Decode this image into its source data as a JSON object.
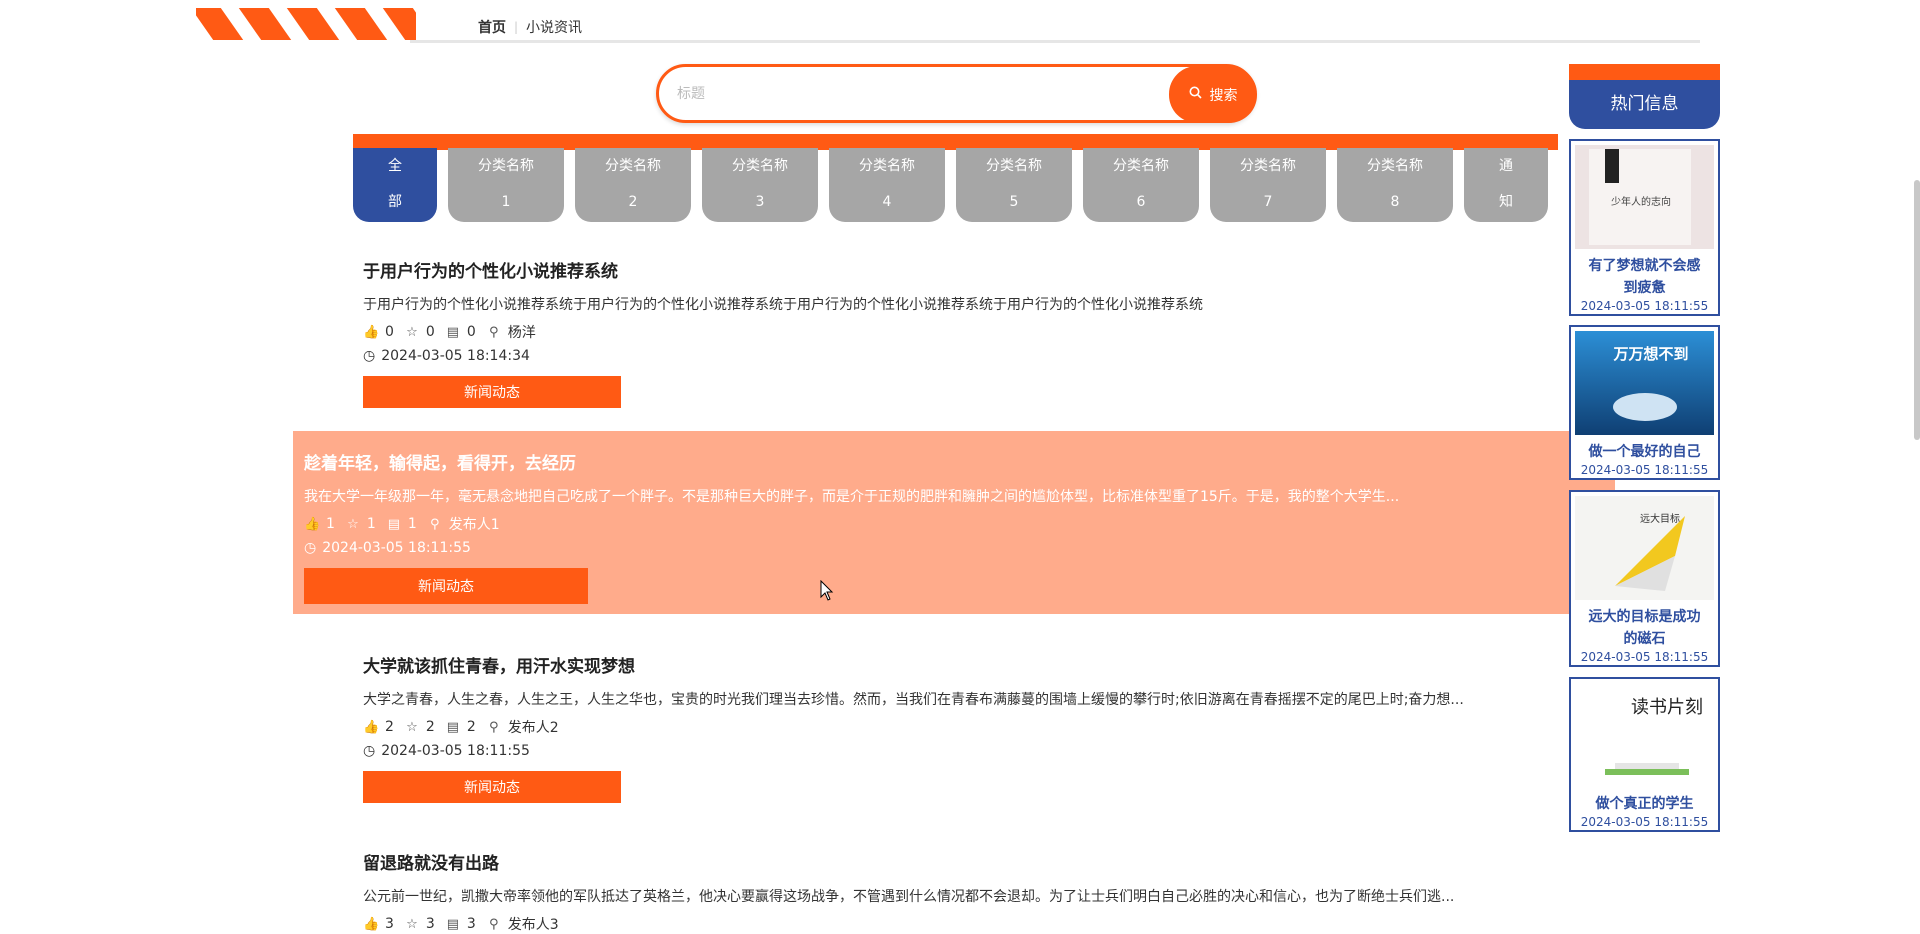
{
  "breadcrumb": {
    "home": "首页",
    "separator": "|",
    "current": "小说资讯"
  },
  "search": {
    "placeholder": "标题",
    "button_label": "搜索"
  },
  "categories": [
    {
      "line1": "全",
      "line2": "部",
      "active": true
    },
    {
      "line1": "分类名称",
      "line2": "1"
    },
    {
      "line1": "分类名称",
      "line2": "2"
    },
    {
      "line1": "分类名称",
      "line2": "3"
    },
    {
      "line1": "分类名称",
      "line2": "4"
    },
    {
      "line1": "分类名称",
      "line2": "5"
    },
    {
      "line1": "分类名称",
      "line2": "6"
    },
    {
      "line1": "分类名称",
      "line2": "7"
    },
    {
      "line1": "分类名称",
      "line2": "8"
    },
    {
      "line1": "通",
      "line2": "知"
    }
  ],
  "news": [
    {
      "title": "于用户行为的个性化小说推荐系统",
      "desc": "于用户行为的个性化小说推荐系统于用户行为的个性化小说推荐系统于用户行为的个性化小说推荐系统于用户行为的个性化小说推荐系统",
      "likes": "0",
      "favorites": "0",
      "comments": "0",
      "author": "杨洋",
      "time": "2024-03-05 18:14:34",
      "button": "新闻动态"
    },
    {
      "title": "趁着年轻，输得起，看得开，去经历",
      "desc": "我在大学一年级那一年，毫无悬念地把自己吃成了一个胖子。不是那种巨大的胖子，而是介于正规的肥胖和臃肿之间的尴尬体型，比标准体型重了15斤。于是，我的整个大学生...",
      "likes": "1",
      "favorites": "1",
      "comments": "1",
      "author": "发布人1",
      "time": "2024-03-05 18:11:55",
      "button": "新闻动态"
    },
    {
      "title": "大学就该抓住青春，用汗水实现梦想",
      "desc": "大学之青春，人生之春，人生之王，人生之华也，宝贵的时光我们理当去珍惜。然而，当我们在青春布满藤蔓的围墙上缓慢的攀行时;依旧游离在青春摇摆不定的尾巴上时;奋力想...",
      "likes": "2",
      "favorites": "2",
      "comments": "2",
      "author": "发布人2",
      "time": "2024-03-05 18:11:55",
      "button": "新闻动态"
    },
    {
      "title": "留退路就没有出路",
      "desc": "公元前一世纪，凯撒大帝率领他的军队抵达了英格兰，他决心要赢得这场战争，不管遇到什么情况都不会退却。为了让士兵们明白自己必胜的决心和信心，也为了断绝士兵们逃...",
      "likes": "3",
      "favorites": "3",
      "comments": "3",
      "author": "发布人3",
      "time": "",
      "button": ""
    }
  ],
  "sidebar": {
    "heading": "热门信息",
    "items": [
      {
        "title_line1": "有了梦想就不会感",
        "title_line2": "到疲惫",
        "time": "2024-03-05 18:11:55",
        "cover_text": "少年人的志向"
      },
      {
        "title_line1": "做一个最好的自己",
        "title_line2": "",
        "time": "2024-03-05 18:11:55",
        "cover_text": "万万想不到"
      },
      {
        "title_line1": "远大的目标是成功",
        "title_line2": "的磁石",
        "time": "2024-03-05 18:11:55",
        "cover_text": "远大目标"
      },
      {
        "title_line1": "做个真正的学生",
        "title_line2": "",
        "time": "2024-03-05 18:11:55",
        "cover_text": "读书片刻"
      }
    ]
  },
  "colors": {
    "accent": "#ff5a14",
    "primary": "#2f4f9f",
    "tab_gray": "#a6a6a6",
    "hover_bg": "#ffab8b"
  }
}
